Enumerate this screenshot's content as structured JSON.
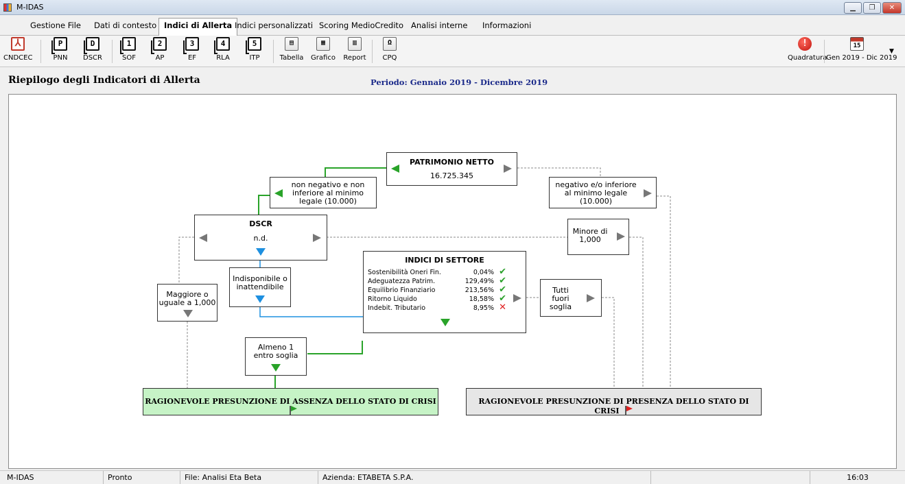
{
  "window": {
    "title": "M-IDAS"
  },
  "menu": {
    "tabs": [
      "Gestione File",
      "Dati di contesto",
      "Indici di Allerta",
      "Indici personalizzati",
      "Scoring MedioCredito",
      "Analisi interne",
      "Informazioni"
    ],
    "active": "Indici di Allerta"
  },
  "toolbar": {
    "items": [
      {
        "label": "CNDCEC",
        "glyph": "⅄",
        "icon": "pdf-icon"
      },
      {
        "label": "PNN",
        "glyph": "P",
        "icon": "pnn-icon"
      },
      {
        "label": "DSCR",
        "glyph": "D",
        "icon": "dscr-icon"
      },
      {
        "label": "SOF",
        "glyph": "1",
        "icon": "sof-icon"
      },
      {
        "label": "AP",
        "glyph": "2",
        "icon": "ap-icon"
      },
      {
        "label": "EF",
        "glyph": "3",
        "icon": "ef-icon"
      },
      {
        "label": "RLA",
        "glyph": "4",
        "icon": "rla-icon"
      },
      {
        "label": "ITP",
        "glyph": "5",
        "icon": "itp-icon"
      },
      {
        "label": "Tabella",
        "glyph": "▤",
        "icon": "table-icon"
      },
      {
        "label": "Grafico",
        "glyph": "▦",
        "icon": "chart-icon"
      },
      {
        "label": "Report",
        "glyph": "▥",
        "icon": "report-icon"
      },
      {
        "label": "CPQ",
        "glyph": "Ω",
        "icon": "cpq-icon"
      }
    ],
    "quadratura": "Quadratura",
    "quadratura_glyph": "!",
    "period_btn": "Gen 2019 - Dic 2019",
    "calendar_day": "15"
  },
  "header": {
    "title": "Riepilogo degli Indicatori di Allerta",
    "period": "Periodo: Gennaio 2019 - Dicembre 2019"
  },
  "diagram": {
    "patrimonio": {
      "title": "PATRIMONIO NETTO",
      "value": "16.725.345"
    },
    "non_negativo": [
      "non negativo e non",
      "inferiore al minimo",
      "legale (10.000)"
    ],
    "negativo": [
      "negativo e/o inferiore",
      "al minimo legale",
      "(10.000)"
    ],
    "dscr": {
      "title": "DSCR",
      "value": "n.d."
    },
    "minore": [
      "Minore di",
      "1,000"
    ],
    "maggiore": [
      "Maggiore o",
      "uguale a 1,000"
    ],
    "indisponibile": [
      "Indisponibile o",
      "inattendibile"
    ],
    "indici": {
      "title": "INDICI DI SETTORE",
      "rows": [
        {
          "name": "Sostenibilità Oneri Fin.",
          "value": "0,04%",
          "mark": "✔",
          "status": "ok"
        },
        {
          "name": "Adeguatezza Patrim.",
          "value": "129,49%",
          "mark": "✔",
          "status": "ok"
        },
        {
          "name": "Equilibrio Finanziario",
          "value": "213,56%",
          "mark": "✔",
          "status": "ok"
        },
        {
          "name": "Ritorno Liquido",
          "value": "18,58%",
          "mark": "✔",
          "status": "ok"
        },
        {
          "name": "Indebit. Tributario",
          "value": "8,95%",
          "mark": "✕",
          "status": "ko"
        }
      ]
    },
    "tutti": [
      "Tutti",
      "fuori",
      "soglia"
    ],
    "almeno": [
      "Almeno 1",
      "entro soglia"
    ],
    "assenza": "RAGIONEVOLE PRESUNZIONE DI ASSENZA DELLO STATO DI CRISI",
    "presenza": "RAGIONEVOLE PRESUNZIONE DI PRESENZA DELLO STATO DI CRISI",
    "colors": {
      "green": "#29a329",
      "blue": "#1e90e0",
      "gray": "#777777",
      "assenza_bg": "#c6f3c6",
      "presenza_bg": "#e6e6e6"
    }
  },
  "status": {
    "app": "M-IDAS",
    "state": "Pronto",
    "file": "File: Analisi Eta Beta",
    "company": "Azienda: ETABETA S.P.A.",
    "time": "16:03"
  }
}
